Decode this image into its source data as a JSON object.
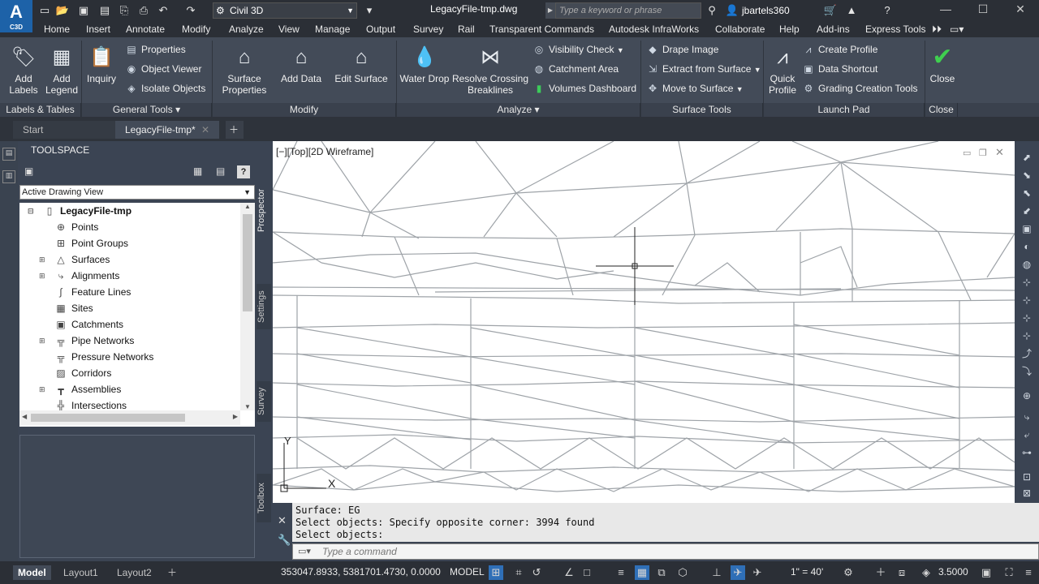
{
  "app": {
    "logo_text": "A",
    "logo_sub": "C3D",
    "workspace": "Civil 3D",
    "file_title": "LegacyFile-tmp.dwg",
    "search_placeholder": "Type a keyword or phrase",
    "user": "jbartels360"
  },
  "menu": [
    "Home",
    "Insert",
    "Annotate",
    "Modify",
    "Analyze",
    "View",
    "Manage",
    "Output",
    "Survey",
    "Rail",
    "Transparent Commands",
    "Autodesk InfraWorks",
    "Collaborate",
    "Help",
    "Add-ins",
    "Express Tools"
  ],
  "ribbon": {
    "labels_tables": {
      "title": "Labels & Tables",
      "add_labels": "Add\nLabels",
      "add_legend": "Add\nLegend"
    },
    "general_tools": {
      "title": "General Tools",
      "inquiry": "Inquiry",
      "properties": "Properties",
      "object_viewer": "Object Viewer",
      "isolate_objects": "Isolate Objects"
    },
    "modify": {
      "title": "Modify",
      "surface_properties": "Surface\nProperties",
      "add_data": "Add Data",
      "edit_surface": "Edit Surface"
    },
    "analyze": {
      "title": "Analyze",
      "water_drop": "Water Drop",
      "resolve_crossing": "Resolve Crossing\nBreaklines",
      "visibility_check": "Visibility Check",
      "catchment_area": "Catchment Area",
      "volumes_dashboard": "Volumes Dashboard"
    },
    "surface_tools": {
      "title": "Surface Tools",
      "drape_image": "Drape Image",
      "extract_from_surface": "Extract from Surface",
      "move_to_surface": "Move to Surface"
    },
    "launch_pad": {
      "title": "Launch Pad",
      "quick_profile": "Quick\nProfile",
      "create_profile": "Create Profile",
      "data_shortcut": "Data Shortcut",
      "grading_creation_tools": "Grading Creation Tools"
    },
    "close": {
      "title": "Close",
      "close": "Close"
    }
  },
  "file_tabs": [
    "Start",
    "LegacyFile-tmp*"
  ],
  "toolspace": {
    "title": "TOOLSPACE",
    "view_select": "Active Drawing View",
    "tree_root": "LegacyFile-tmp",
    "tree_items": [
      "Points",
      "Point Groups",
      "Surfaces",
      "Alignments",
      "Feature Lines",
      "Sites",
      "Catchments",
      "Pipe Networks",
      "Pressure Networks",
      "Corridors",
      "Assemblies",
      "Intersections"
    ],
    "side_tabs": [
      "Prospector",
      "Settings",
      "Survey",
      "Toolbox"
    ]
  },
  "viewport": {
    "label": "[−][Top][2D Wireframe]",
    "ucs_y": "Y",
    "ucs_x": "X"
  },
  "command": {
    "history": [
      "Surface:  EG",
      "Select objects: Specify opposite corner: 3994 found",
      "Select objects:"
    ],
    "placeholder": "Type a command"
  },
  "status": {
    "tabs": [
      "Model",
      "Layout1",
      "Layout2"
    ],
    "coords": "353047.8933, 5381701.4730, 0.0000",
    "space": "MODEL",
    "scale": "1\" = 40'",
    "elevation": "3.5000"
  }
}
